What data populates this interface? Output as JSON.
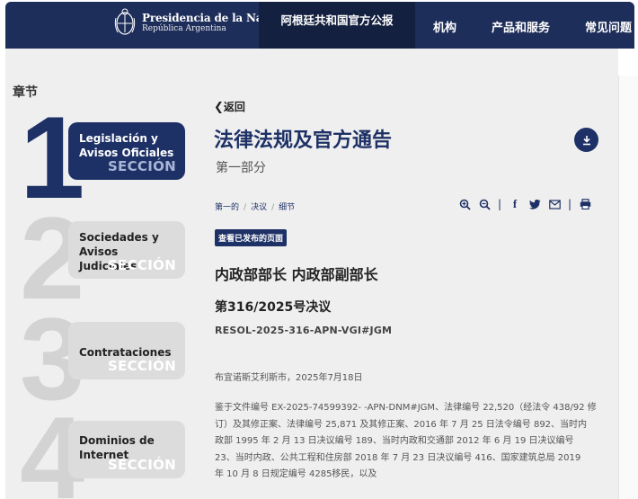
{
  "header": {
    "logo_title": "Presidencia de la Nación",
    "logo_subtitle": "República Argentina",
    "nav": {
      "active": "阿根廷共和国官方公报",
      "items": [
        "机构",
        "产品和服务",
        "常见问题"
      ]
    }
  },
  "sidebar": {
    "heading": "章节",
    "sections": [
      {
        "number": "1",
        "name_line1": "Legislación y",
        "name_line2": "Avisos Oficiales",
        "label": "SECCIÓN",
        "active": true
      },
      {
        "number": "2",
        "name_line1": "Sociedades y",
        "name_line2": "Avisos Judiciales",
        "label": "SECCIÓN",
        "active": false
      },
      {
        "number": "3",
        "name_line1": "Contrataciones",
        "name_line2": "",
        "label": "SECCIÓN",
        "active": false
      },
      {
        "number": "4",
        "name_line1": "Dominios de",
        "name_line2": "Internet",
        "label": "SECCIÓN",
        "active": false
      }
    ]
  },
  "main": {
    "back": "返回",
    "title": "法律法规及官方通告",
    "subtitle": "第一部分",
    "breadcrumb": [
      "第一的",
      "决议",
      "细节"
    ],
    "badge": "查看已发布的页面",
    "organization": "内政部部长 内政部副部长",
    "resolution": "第316/2025号决议",
    "code": "RESOL-2025-316-APN-VGI#JGM",
    "place_date": "布宜诺斯艾利斯市，2025年7月18日",
    "body_lines": [
      "鉴于文件编号 EX-2025-74599392- -APN-DNM#JGM、法律编号 22,520（经法令 438/92 修",
      "订）及其修正案、法律编号 25,871 及其修正案、2016 年 7 月 25 日法令编号 892、当时内",
      "政部 1995 年 2 月 13 日决议编号 189、当时内政和交通部 2012 年 6 月 19 日决议编号",
      "23、当时内政、公共工程和住房部 2018 年 7 月 23 日决议编号 416、国家建筑总局 2019",
      "年 10 月 8 日规定编号 4285移民，以及"
    ]
  },
  "colors": {
    "navy": "#1e3166",
    "header": "#1e2e5a",
    "background": "#efefef"
  },
  "icons": [
    "argentina-seal-icon",
    "chevron-left-icon",
    "download-icon",
    "zoom-in-icon",
    "zoom-out-icon",
    "facebook-icon",
    "twitter-icon",
    "email-icon",
    "print-icon"
  ]
}
